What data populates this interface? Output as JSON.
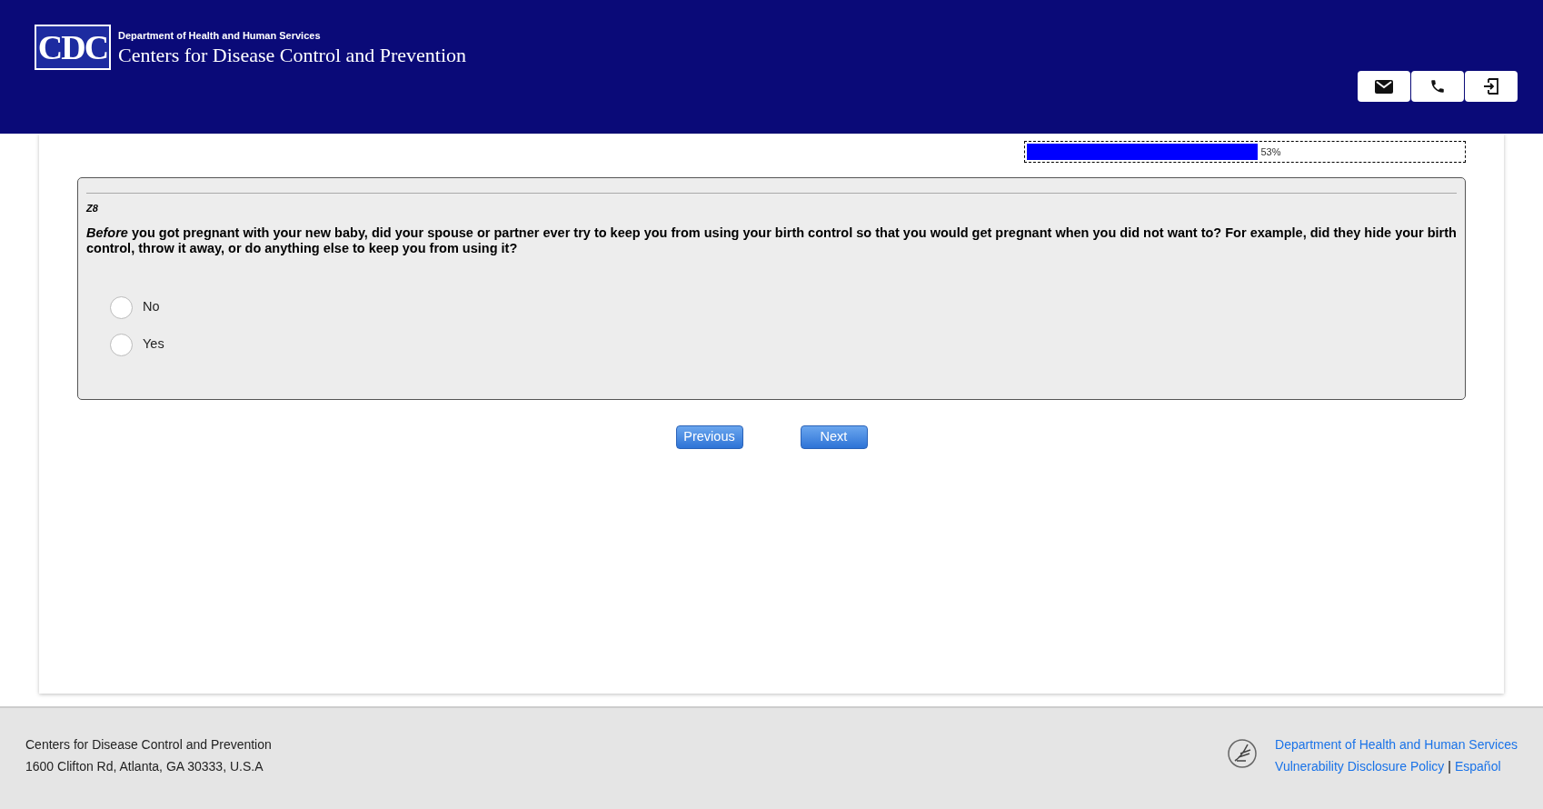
{
  "header": {
    "logo": "CDC",
    "department": "Department of Health and Human Services",
    "agency": "Centers for Disease Control and Prevention"
  },
  "progress": {
    "level": 0.53,
    "reading": "53%"
  },
  "question": {
    "id": "Z8",
    "text": "*Before* you got pregnant with your new baby, did your spouse or partner ever try to keep you from using your birth control so that you would get pregnant when you did not want to? For example, did they hide your birth control, throw it away, or do anything else to keep you from using it?",
    "options": [
      {
        "label": "No",
        "selected": false
      },
      {
        "label": "Yes",
        "selected": false
      }
    ]
  },
  "buttons": [
    "Previous",
    "Next"
  ],
  "footer": {
    "address_lines": [
      "Centers for Disease Control and Prevention",
      "1600 Clifton Rd, Atlanta, GA 30333, U.S.A"
    ],
    "links": [
      "Department of Health and Human Services",
      "Vulnerability Disclosure Policy",
      "Español"
    ],
    "separator": "|"
  }
}
